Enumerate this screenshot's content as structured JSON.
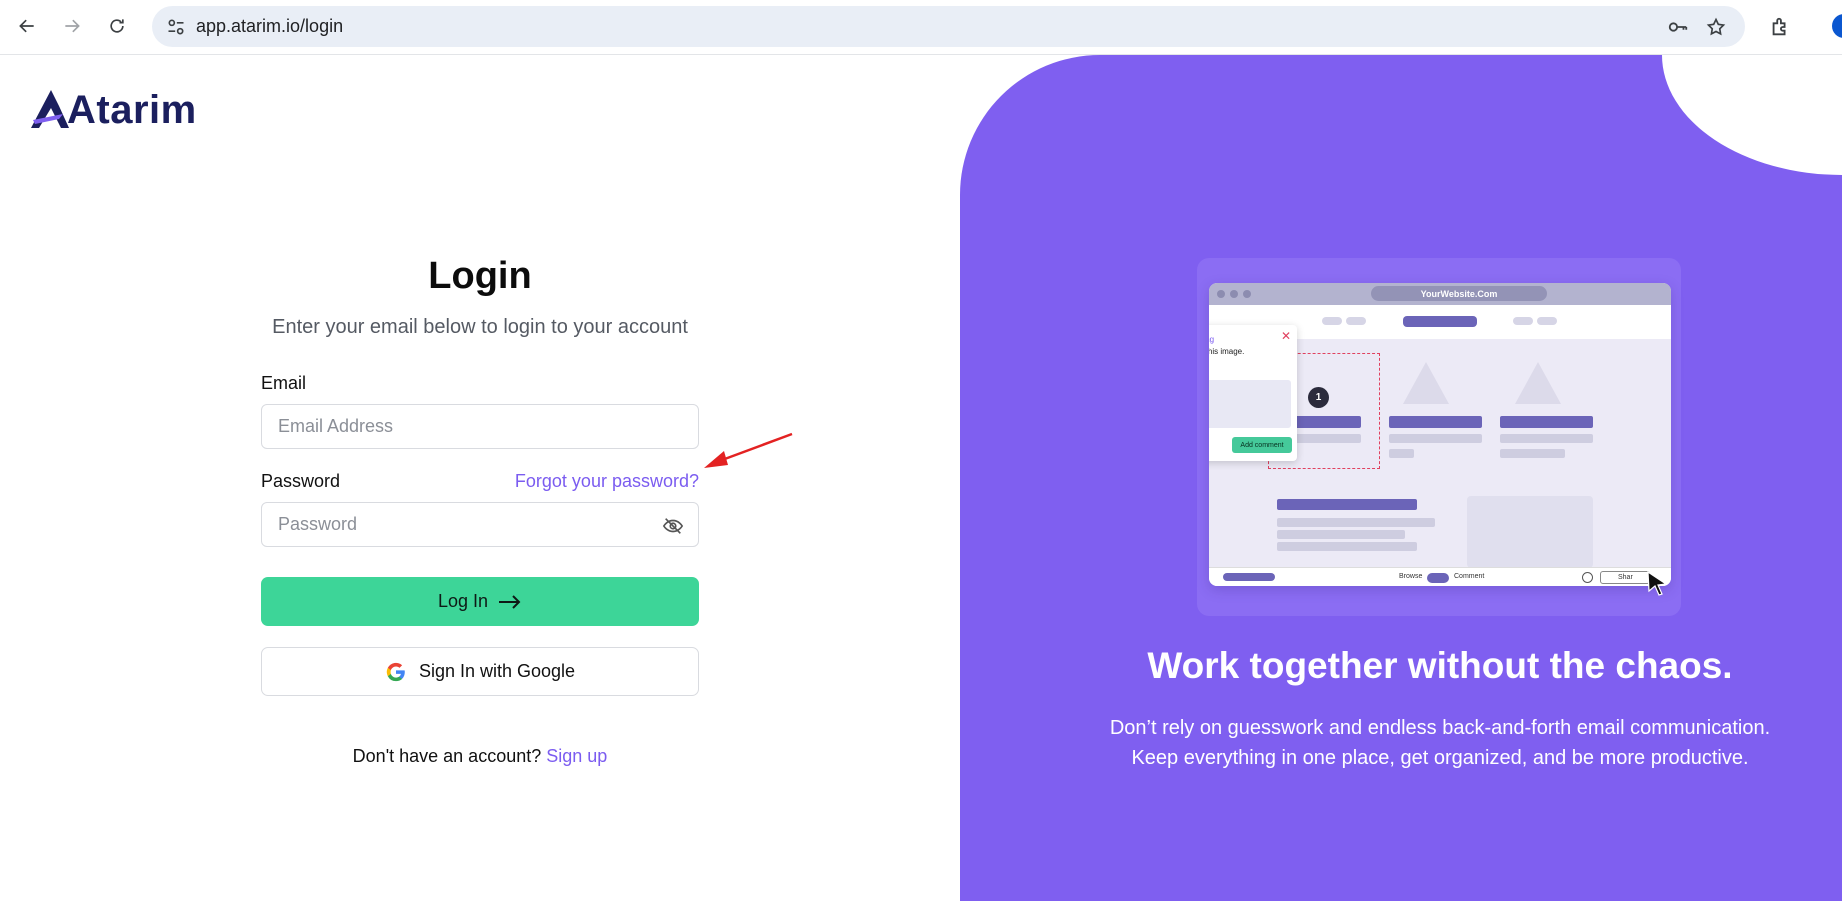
{
  "browser": {
    "url": "app.atarim.io/login"
  },
  "brand": {
    "name": "Atarim",
    "primary_color": "#7f5ff0",
    "accent_green": "#3dd598",
    "logo_dark": "#1b1f5e"
  },
  "login": {
    "title": "Login",
    "subtitle": "Enter your email below to login to your account",
    "email_label": "Email",
    "email_placeholder": "Email Address",
    "password_label": "Password",
    "forgot_link": "Forgot your password?",
    "password_placeholder": "Password",
    "login_button": "Log In",
    "google_button": "Sign In with Google",
    "signup_prompt": "Don't have an account?",
    "signup_link": "Sign up"
  },
  "promo": {
    "mockup": {
      "site_url": "YourWebsite.Com",
      "comment_heading_fragment": "ning",
      "comment_text_fragment": "e this image.",
      "pin_number": "1",
      "add_comment_button": "Add comment",
      "browse_label": "Browse",
      "comment_label": "Comment",
      "share_label": "Shar"
    },
    "headline": "Work together without the chaos.",
    "description_line1": "Don’t rely on guesswork and endless back-and-forth email communication.",
    "description_line2": "Keep everything in one place, get organized, and be more productive."
  }
}
